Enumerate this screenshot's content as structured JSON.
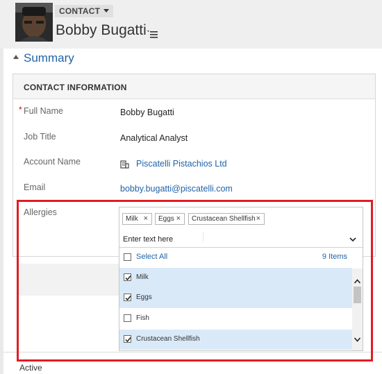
{
  "header": {
    "entity_type": "CONTACT",
    "record_name": "Bobby Bugatti"
  },
  "summary": {
    "title": "Summary"
  },
  "contact_info": {
    "section_title": "CONTACT INFORMATION",
    "required_marker": "*",
    "fields": {
      "full_name": {
        "label": "Full Name",
        "value": "Bobby Bugatti"
      },
      "job_title": {
        "label": "Job Title",
        "value": "Analytical Analyst"
      },
      "account_name": {
        "label": "Account Name",
        "value": "Piscatelli Pistachios Ltd"
      },
      "email": {
        "label": "Email",
        "value": "bobby.bugatti@piscatelli.com"
      },
      "allergies": {
        "label": "Allergies"
      }
    }
  },
  "allergies_control": {
    "tags": [
      "Milk",
      "Eggs",
      "Crustacean Shellfish"
    ],
    "tag_remove_glyph": "×",
    "input_value": "Enter text here",
    "select_all_label": "Select All",
    "items_count": "9 Items",
    "options": [
      {
        "label": "Milk",
        "checked": true
      },
      {
        "label": "Eggs",
        "checked": true
      },
      {
        "label": "Fish",
        "checked": false
      },
      {
        "label": "Crustacean Shellfish",
        "checked": true
      }
    ]
  },
  "footer": {
    "status_label": "Active"
  },
  "colors": {
    "accent": "#1f63a8",
    "selected_row": "#d9e9f8",
    "highlight_border": "#e31b23",
    "required": "#cc0000"
  }
}
